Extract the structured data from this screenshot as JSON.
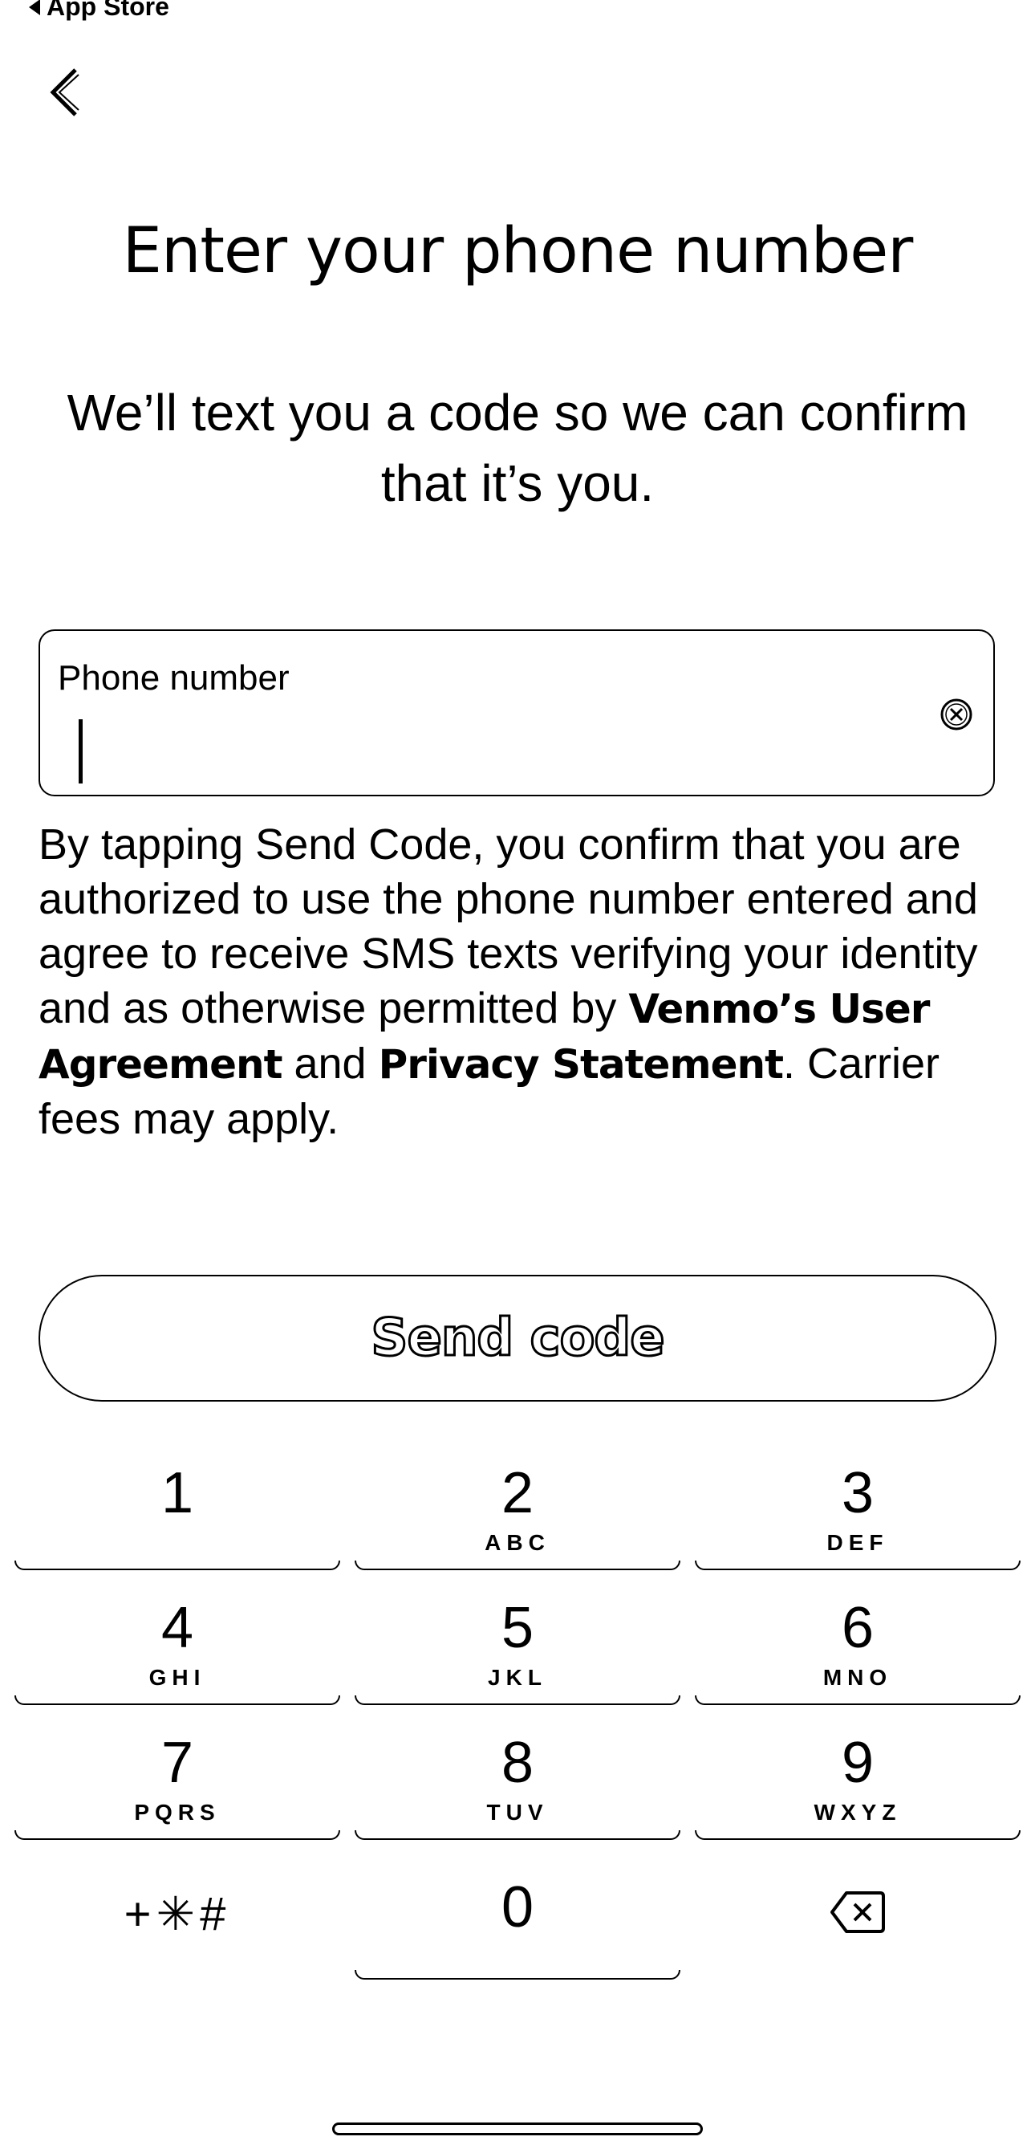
{
  "status_bar": {
    "back_app_label": "App Store"
  },
  "header": {
    "back_icon": "chevron-left-icon"
  },
  "title": "Enter your phone number",
  "subtitle": "We’ll text you a code so we can confirm that it’s you.",
  "phone_field": {
    "label": "Phone number",
    "value": "",
    "clear_icon": "clear-circle-x-icon"
  },
  "disclaimer": {
    "text_before": "By tapping Send Code, you confirm that you are authorized to use the phone number entered and agree to receive SMS texts verifying your identity and as otherwise permitted by ",
    "link_user_agreement": "Venmo’s User Agreement",
    "text_and": " and ",
    "link_privacy": "Privacy Statement",
    "text_after": ". Carrier fees may apply."
  },
  "send_button": {
    "label": "Send code"
  },
  "keypad": {
    "keys": [
      {
        "num": "1",
        "letters": ""
      },
      {
        "num": "2",
        "letters": "ABC"
      },
      {
        "num": "3",
        "letters": "DEF"
      },
      {
        "num": "4",
        "letters": "GHI"
      },
      {
        "num": "5",
        "letters": "JKL"
      },
      {
        "num": "6",
        "letters": "MNO"
      },
      {
        "num": "7",
        "letters": "PQRS"
      },
      {
        "num": "8",
        "letters": "TUV"
      },
      {
        "num": "9",
        "letters": "WXYZ"
      }
    ],
    "symbols_key": "+✳#",
    "zero_key": "0",
    "delete_icon": "backspace-icon"
  }
}
